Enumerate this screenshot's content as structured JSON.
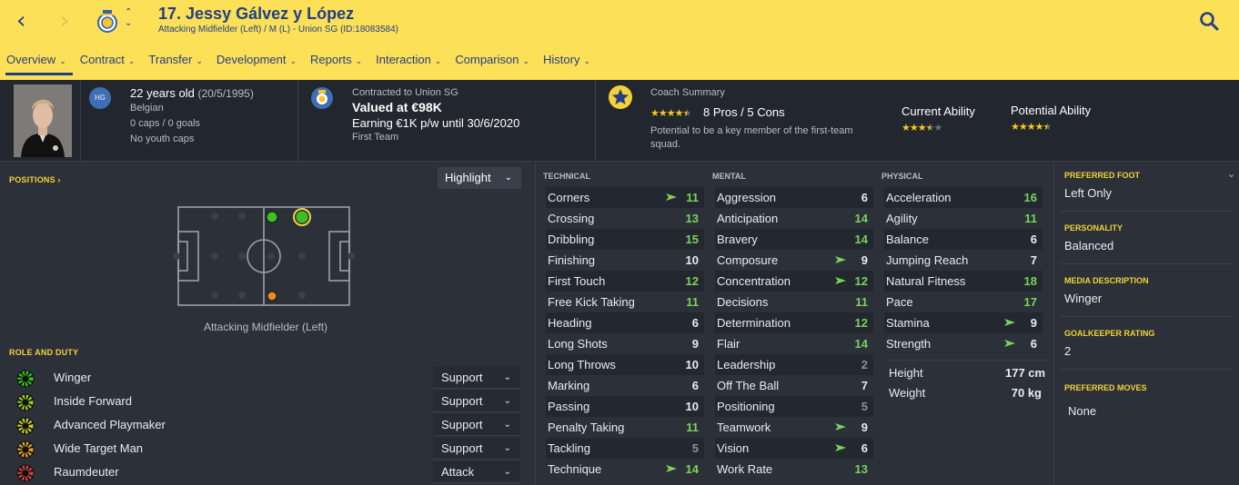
{
  "header": {
    "title": "17. Jessy Gálvez y López",
    "subtitle": "Attacking Midfielder (Left) / M (L) - Union SG (ID:18083584)",
    "back_icon": "chevron-left-icon",
    "forward_icon": "chevron-right-icon",
    "search_icon": "search-icon",
    "colors": {
      "bg": "#fbe058",
      "fg": "#243e86"
    }
  },
  "nav": [
    "Overview",
    "Contract",
    "Transfer",
    "Development",
    "Reports",
    "Interaction",
    "Comparison",
    "History"
  ],
  "info": {
    "age": "22 years old",
    "dob": "(20/5/1995)",
    "nationality": "Belgian",
    "caps": "0 caps / 0 goals",
    "youth": "No youth caps",
    "hg_badge": "HG",
    "contracted": "Contracted to Union SG",
    "value": "Valued at €98K",
    "earning": "Earning €1K p/w until 30/6/2020",
    "squad": "First Team",
    "coach_title": "Coach Summary",
    "pros_cons": "8 Pros / 5 Cons",
    "coach_rating": 4.5,
    "coach_text_1": "Potential to be a key member of the first-team",
    "coach_text_2": "squad.",
    "current_ability_label": "Current Ability",
    "current_ability": 3.5,
    "potential_ability_label": "Potential Ability",
    "potential_ability": 4.5
  },
  "positions": {
    "title": "POSITIONS",
    "highlight_label": "Highlight",
    "caption": "Attacking Midfielder (Left)"
  },
  "roles": {
    "title": "ROLE AND DUTY",
    "items": [
      {
        "name": "Winger",
        "duty": "Support",
        "color": "#36c521"
      },
      {
        "name": "Inside Forward",
        "duty": "Support",
        "color": "#95cc2a"
      },
      {
        "name": "Advanced Playmaker",
        "duty": "Support",
        "color": "#c8cb2c"
      },
      {
        "name": "Wide Target Man",
        "duty": "Support",
        "color": "#e0a032"
      },
      {
        "name": "Raumdeuter",
        "duty": "Attack",
        "color": "#d1433e"
      }
    ]
  },
  "attributes": {
    "technical": {
      "title": "TECHNICAL",
      "items": [
        {
          "name": "Corners",
          "value": "11",
          "flag": true
        },
        {
          "name": "Crossing",
          "value": "13",
          "flag": false
        },
        {
          "name": "Dribbling",
          "value": "15",
          "flag": false
        },
        {
          "name": "Finishing",
          "value": "10",
          "flag": false
        },
        {
          "name": "First Touch",
          "value": "12",
          "flag": false
        },
        {
          "name": "Free Kick Taking",
          "value": "11",
          "flag": false
        },
        {
          "name": "Heading",
          "value": "6",
          "flag": false
        },
        {
          "name": "Long Shots",
          "value": "9",
          "flag": false
        },
        {
          "name": "Long Throws",
          "value": "10",
          "flag": false
        },
        {
          "name": "Marking",
          "value": "6",
          "flag": false
        },
        {
          "name": "Passing",
          "value": "10",
          "flag": false
        },
        {
          "name": "Penalty Taking",
          "value": "11",
          "flag": false
        },
        {
          "name": "Tackling",
          "value": "5",
          "flag": false
        },
        {
          "name": "Technique",
          "value": "14",
          "flag": true
        }
      ]
    },
    "mental": {
      "title": "MENTAL",
      "items": [
        {
          "name": "Aggression",
          "value": "6",
          "flag": false
        },
        {
          "name": "Anticipation",
          "value": "14",
          "flag": false
        },
        {
          "name": "Bravery",
          "value": "14",
          "flag": false
        },
        {
          "name": "Composure",
          "value": "9",
          "flag": true
        },
        {
          "name": "Concentration",
          "value": "12",
          "flag": true
        },
        {
          "name": "Decisions",
          "value": "11",
          "flag": false
        },
        {
          "name": "Determination",
          "value": "12",
          "flag": false
        },
        {
          "name": "Flair",
          "value": "14",
          "flag": false
        },
        {
          "name": "Leadership",
          "value": "2",
          "flag": false
        },
        {
          "name": "Off The Ball",
          "value": "7",
          "flag": false
        },
        {
          "name": "Positioning",
          "value": "5",
          "flag": false
        },
        {
          "name": "Teamwork",
          "value": "9",
          "flag": true
        },
        {
          "name": "Vision",
          "value": "6",
          "flag": true
        },
        {
          "name": "Work Rate",
          "value": "13",
          "flag": false
        }
      ]
    },
    "physical": {
      "title": "PHYSICAL",
      "items": [
        {
          "name": "Acceleration",
          "value": "16",
          "flag": false
        },
        {
          "name": "Agility",
          "value": "11",
          "flag": false
        },
        {
          "name": "Balance",
          "value": "6",
          "flag": false
        },
        {
          "name": "Jumping Reach",
          "value": "7",
          "flag": false
        },
        {
          "name": "Natural Fitness",
          "value": "18",
          "flag": false
        },
        {
          "name": "Pace",
          "value": "17",
          "flag": false
        },
        {
          "name": "Stamina",
          "value": "9",
          "flag": true
        },
        {
          "name": "Strength",
          "value": "6",
          "flag": true
        }
      ],
      "height_label": "Height",
      "height": "177 cm",
      "weight_label": "Weight",
      "weight": "70 kg"
    }
  },
  "side": {
    "foot_title": "PREFERRED FOOT",
    "foot": "Left Only",
    "personality_title": "PERSONALITY",
    "personality": "Balanced",
    "media_title": "MEDIA DESCRIPTION",
    "media": "Winger",
    "gk_title": "GOALKEEPER RATING",
    "gk": "2",
    "moves_title": "PREFERRED MOVES",
    "moves": "None"
  }
}
